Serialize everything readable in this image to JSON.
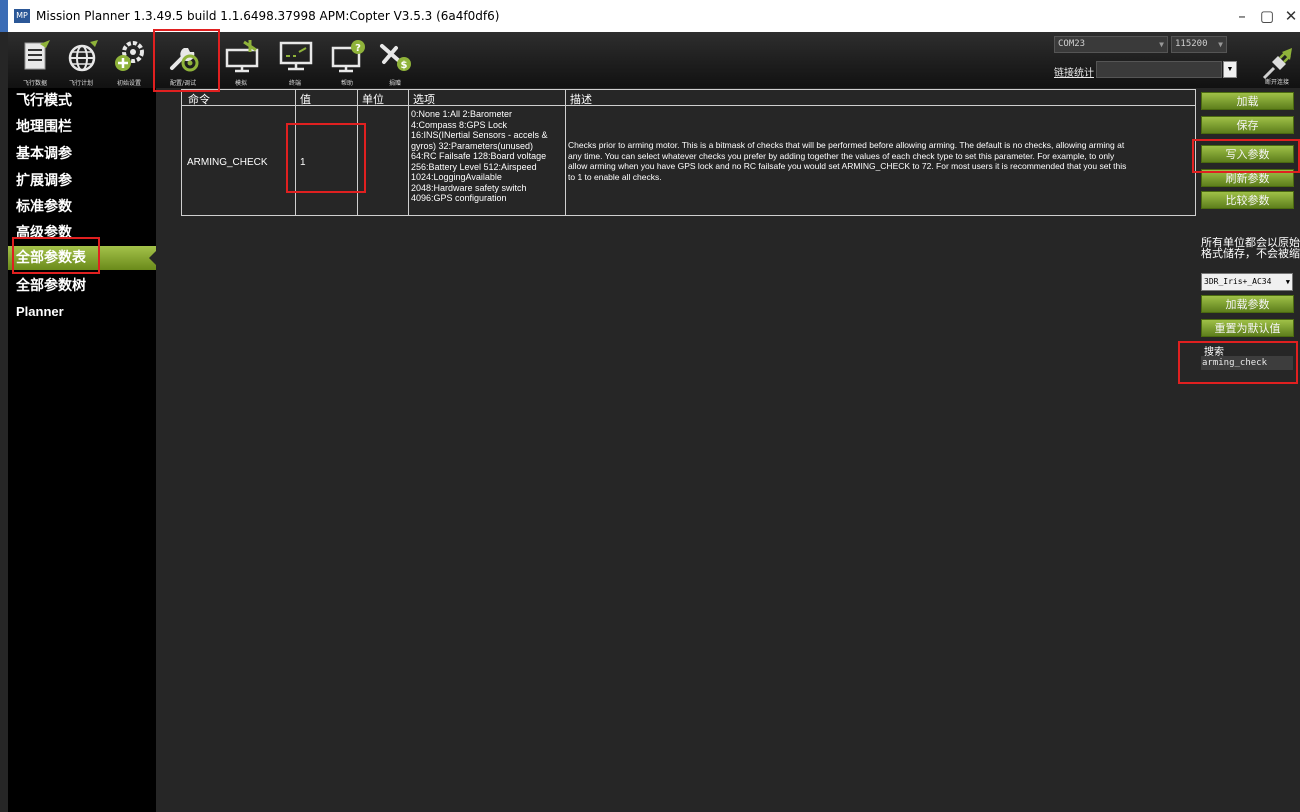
{
  "window": {
    "title": "Mission Planner 1.3.49.5 build 1.1.6498.37998 APM:Copter V3.5.3 (6a4f0df6)",
    "app_icon": "MP",
    "minimize": "–",
    "maximize": "▢",
    "close": "✕"
  },
  "toolbar": {
    "buttons": [
      {
        "label": "飞行数据",
        "icon": "flight-data-icon"
      },
      {
        "label": "飞行计划",
        "icon": "flight-plan-icon"
      },
      {
        "label": "初始设置",
        "icon": "initial-setup-icon"
      },
      {
        "label": "配置/调试",
        "icon": "config-tuning-icon"
      },
      {
        "label": "模拟",
        "icon": "simulation-icon"
      },
      {
        "label": "终端",
        "icon": "terminal-icon"
      },
      {
        "label": "帮助",
        "icon": "help-icon"
      },
      {
        "label": "捐赠",
        "icon": "donate-icon"
      }
    ],
    "port": "COM23",
    "baud": "115200",
    "link_stats": "链接统计",
    "connect_label": "断开连接"
  },
  "sidebar": {
    "items": [
      {
        "label": "飞行模式"
      },
      {
        "label": "地理围栏"
      },
      {
        "label": "基本调参"
      },
      {
        "label": "扩展调参"
      },
      {
        "label": "标准参数"
      },
      {
        "label": "高级参数"
      },
      {
        "label": "全部参数表",
        "active": true
      },
      {
        "label": "全部参数树"
      },
      {
        "label": "Planner"
      }
    ]
  },
  "grid": {
    "headers": {
      "command": "命令",
      "value": "值",
      "unit": "单位",
      "options": "选项",
      "description": "描述"
    },
    "rows": [
      {
        "command": "ARMING_CHECK",
        "value": "1",
        "unit": "",
        "options": [
          "0:None 1:All 2:Barometer",
          "4:Compass 8:GPS Lock",
          "16:INS(INertial Sensors - accels &",
          "gyros) 32:Parameters(unused)",
          "64:RC Failsafe 128:Board voltage",
          "256:Battery Level 512:Airspeed",
          "1024:LoggingAvailable",
          "2048:Hardware safety switch",
          "4096:GPS configuration"
        ],
        "description": [
          "Checks prior to arming motor. This is a bitmask of checks that will be performed before allowing arming. The default is no checks, allowing arming at",
          "any time. You can select whatever checks you prefer by adding together the values of each check type to set this parameter. For example, to only",
          "allow arming when you have GPS lock and no RC failsafe you would set ARMING_CHECK to 72. For most users it is recommended that you set this",
          "to 1 to enable all checks."
        ]
      }
    ]
  },
  "right_panel": {
    "load": "加载",
    "save": "保存",
    "write": "写入参数",
    "refresh": "刷新参数",
    "compare": "比较参数",
    "note_line1": "所有单位都会以原始",
    "note_line2": "格式储存，不会被缩",
    "firmware": "3DR_Iris+_AC34",
    "load_params": "加载参数",
    "reset_default": "重置为默认值",
    "search_label": "搜索",
    "search_value": "arming_check"
  },
  "colors": {
    "accent_green": "#8fb33a",
    "highlight_red": "#e02020",
    "background": "#262626"
  }
}
